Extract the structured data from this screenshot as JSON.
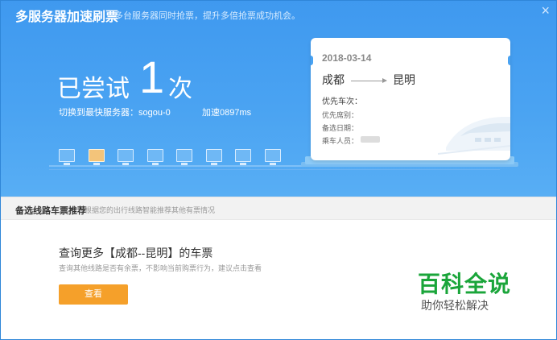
{
  "window": {
    "title": "多服务器加速刷票",
    "subtitle": "多台服务器同时抢票，提升多倍抢票成功机会。",
    "close_symbol": "×"
  },
  "status": {
    "tried_prefix": "已尝试",
    "tried_count": "1",
    "tried_suffix": "次",
    "switch_text": "切换到最快服务器：sogou-0",
    "speed_text": "加速0897ms"
  },
  "servers": {
    "count": 8,
    "active_index": 1
  },
  "ticket": {
    "date": "2018-03-14",
    "from": "成都",
    "to": "昆明",
    "priority_train_label": "优先车次：",
    "priority_seat_label": "优先席别：",
    "backup_date_label": "备选日期：",
    "passengers_label": "乘车人员："
  },
  "recommend": {
    "header": "备选线路车票推荐",
    "desc": "根据您的出行线路智能推荐其他有票情况",
    "query_title": "查询更多【成都--昆明】的车票",
    "query_desc": "查询其他线路是否有余票，不影响当前购票行为，建议点击查看",
    "view_button": "查看"
  },
  "watermark": {
    "line1": "百科全说",
    "line2": "助你轻松解决"
  },
  "colors": {
    "header_blue": "#4aa3f2",
    "button_orange": "#f5a02a",
    "watermark_green": "#1aa53a"
  }
}
